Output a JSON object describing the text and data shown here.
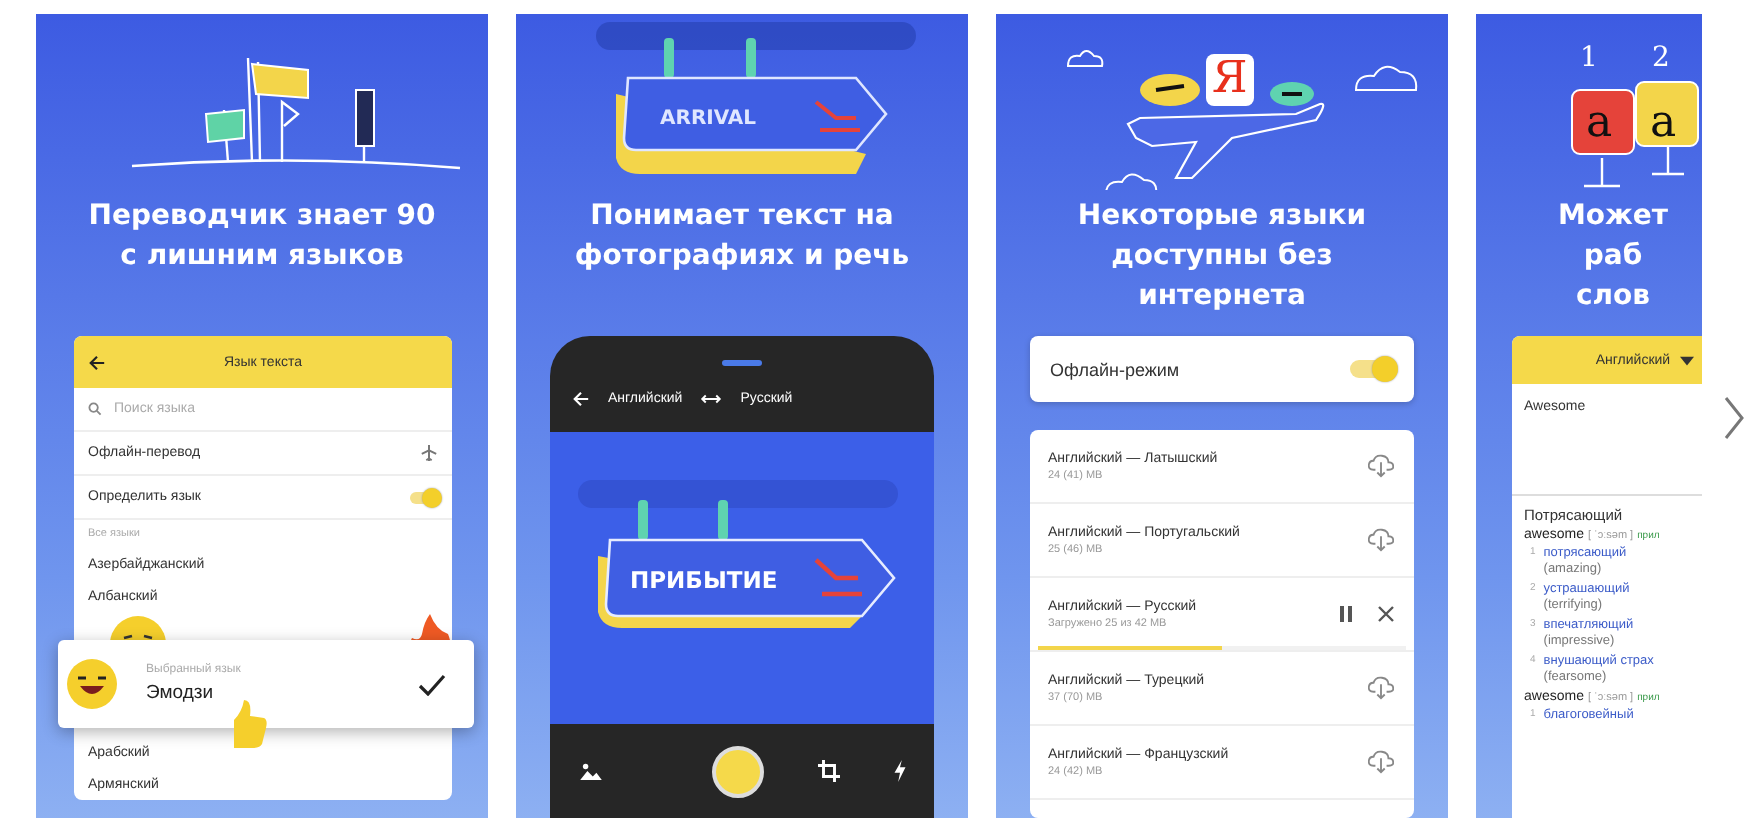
{
  "panels": [
    {
      "kind": "language_list",
      "title": "Переводчик знает 90\nс лишним языков",
      "header": "Язык текста",
      "search": {
        "placeholder": "Поиск языка"
      },
      "settings": [
        {
          "kind": "offline",
          "label": "Офлайн-перевод"
        },
        {
          "kind": "toggle",
          "label": "Определить язык",
          "on": true
        }
      ],
      "section": "Все языки",
      "languages_before": [
        "Азербайджанский",
        "Албанский"
      ],
      "popup": {
        "caption": "Выбранный язык",
        "language": "Эмодзи",
        "checked": true
      },
      "languages_after": [
        "Арабский",
        "Армянский"
      ]
    },
    {
      "kind": "camera",
      "title": "Понимает текст на\nфотографиях и речь",
      "illustration_text": "ARRIVAL",
      "source_language": "Английский",
      "target_language": "Русский",
      "sign_text": "ПРИБЫТИЕ"
    },
    {
      "kind": "offline",
      "title": "Некоторые языки\nдоступны без\nинтернета",
      "logo_letter": "Я",
      "mode": {
        "label": "Офлайн-режим",
        "on": true
      },
      "packages": [
        {
          "kind": "available",
          "name": "Английский — Латышский",
          "size": "24 (41) MB"
        },
        {
          "kind": "available",
          "name": "Английский — Португальский",
          "size": "25 (46) MB"
        },
        {
          "kind": "downloading",
          "name": "Английский — Русский",
          "size": "Загружено 25 из 42 MB",
          "level": 0.5
        },
        {
          "kind": "available",
          "name": "Английский — Турецкий",
          "size": "37 (70) MB"
        },
        {
          "kind": "available",
          "name": "Английский — Французский",
          "size": "24 (42) MB"
        }
      ]
    },
    {
      "kind": "dictionary",
      "title": "Может раб\nслов",
      "illustration_labels": [
        "1",
        "2",
        "a",
        "a"
      ],
      "source_language": "Английский",
      "input": "Awesome",
      "translation": "Потрясающий",
      "entries": [
        {
          "word": "awesome",
          "transcription": "[ ˈɔːsəm ]",
          "part_of_speech": "прил",
          "senses": [
            {
              "number": "1",
              "translation": "потрясающий",
              "gloss": "(amazing)"
            },
            {
              "number": "2",
              "translation": "устрашающий",
              "gloss": "(terrifying)"
            },
            {
              "number": "3",
              "translation": "впечатляющий",
              "gloss": "(impressive)"
            },
            {
              "number": "4",
              "translation": "внушающий страх",
              "gloss": "(fearsome)"
            }
          ]
        },
        {
          "word": "awesome",
          "transcription": "[ ˈɔːsəm ]",
          "part_of_speech": "прил",
          "senses": [
            {
              "number": "1",
              "translation": "благоговейный"
            }
          ]
        }
      ]
    }
  ]
}
